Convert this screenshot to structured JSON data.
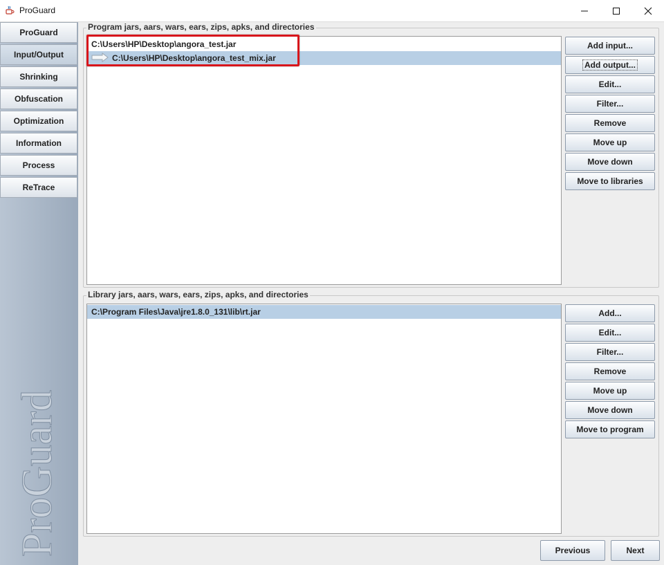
{
  "window": {
    "title": "ProGuard",
    "app_icon": "java-cup-icon",
    "controls": [
      "minimize-icon",
      "maximize-icon",
      "close-icon"
    ]
  },
  "sidebar": {
    "items": [
      {
        "label": "ProGuard",
        "active": false
      },
      {
        "label": "Input/Output",
        "active": true
      },
      {
        "label": "Shrinking",
        "active": false
      },
      {
        "label": "Obfuscation",
        "active": false
      },
      {
        "label": "Optimization",
        "active": false
      },
      {
        "label": "Information",
        "active": false
      },
      {
        "label": "Process",
        "active": false
      },
      {
        "label": "ReTrace",
        "active": false
      }
    ],
    "watermark_text": "ProGuard"
  },
  "program_section": {
    "title": "Program jars, aars, wars, ears, zips, apks, and directories",
    "entries": [
      {
        "path": "C:\\Users\\HP\\Desktop\\angora_test.jar",
        "kind": "input",
        "selected": false
      },
      {
        "path": "C:\\Users\\HP\\Desktop\\angora_test_mix.jar",
        "kind": "output",
        "selected": true,
        "icon": "output-arrow-icon"
      }
    ],
    "buttons": [
      "Add input...",
      "Add output...",
      "Edit...",
      "Filter...",
      "Remove",
      "Move up",
      "Move down",
      "Move to libraries"
    ]
  },
  "library_section": {
    "title": "Library jars, aars, wars, ears, zips, apks, and directories",
    "entries": [
      {
        "path": "C:\\Program Files\\Java\\jre1.8.0_131\\lib\\rt.jar",
        "selected": true
      }
    ],
    "buttons": [
      "Add...",
      "Edit...",
      "Filter...",
      "Remove",
      "Move up",
      "Move down",
      "Move to program"
    ]
  },
  "navigation": {
    "previous": "Previous",
    "next": "Next"
  },
  "colors": {
    "selection": "#b8cfe5",
    "highlight_annotation": "#d8151b",
    "sidebar_gradient": "#9aa9bb"
  }
}
